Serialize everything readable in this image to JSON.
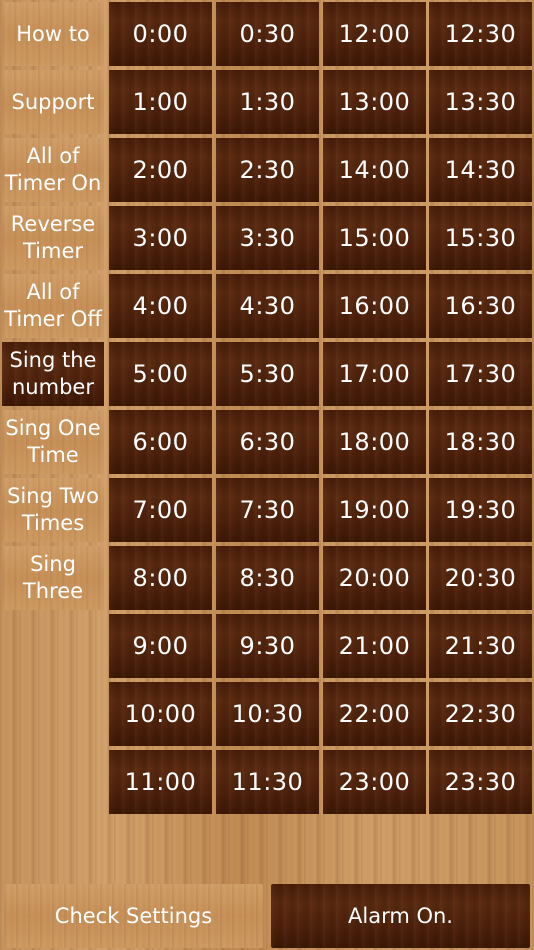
{
  "side_menu": [
    {
      "id": "how-to",
      "label": "How to",
      "style": "light"
    },
    {
      "id": "support",
      "label": "Support",
      "style": "light"
    },
    {
      "id": "all-timer-on",
      "label": "All of\nTimer On",
      "style": "light"
    },
    {
      "id": "reverse-timer",
      "label": "Reverse\nTimer",
      "style": "light"
    },
    {
      "id": "all-timer-off",
      "label": "All of\nTimer Off",
      "style": "light"
    },
    {
      "id": "sing-number",
      "label": "Sing the\nnumber",
      "style": "dark"
    },
    {
      "id": "sing-one-time",
      "label": "Sing One\nTime",
      "style": "light"
    },
    {
      "id": "sing-two-times",
      "label": "Sing Two\nTimes",
      "style": "light"
    },
    {
      "id": "sing-three",
      "label": "Sing\nThree",
      "style": "light"
    }
  ],
  "time_grid": [
    [
      "0:00",
      "0:30",
      "12:00",
      "12:30"
    ],
    [
      "1:00",
      "1:30",
      "13:00",
      "13:30"
    ],
    [
      "2:00",
      "2:30",
      "14:00",
      "14:30"
    ],
    [
      "3:00",
      "3:30",
      "15:00",
      "15:30"
    ],
    [
      "4:00",
      "4:30",
      "16:00",
      "16:30"
    ],
    [
      "5:00",
      "5:30",
      "17:00",
      "17:30"
    ],
    [
      "6:00",
      "6:30",
      "18:00",
      "18:30"
    ],
    [
      "7:00",
      "7:30",
      "19:00",
      "19:30"
    ],
    [
      "8:00",
      "8:30",
      "20:00",
      "20:30"
    ],
    [
      "9:00",
      "9:30",
      "21:00",
      "21:30"
    ],
    [
      "10:00",
      "10:30",
      "22:00",
      "22:30"
    ],
    [
      "11:00",
      "11:30",
      "23:00",
      "23:30"
    ]
  ],
  "bottom_bar": {
    "check_settings_label": "Check Settings",
    "alarm_label": "Alarm On."
  },
  "colors": {
    "dark_wood": "#4a1f0a",
    "light_wood": "#c8925a",
    "text": "#ffffff",
    "grid_lines": "#ffffff"
  }
}
